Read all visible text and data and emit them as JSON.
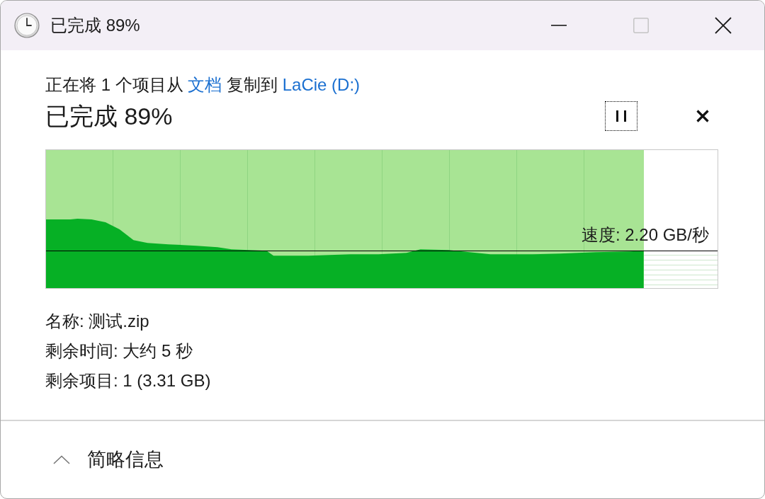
{
  "window": {
    "title": "已完成 89%",
    "maximize_disabled": true
  },
  "copy_summary": [
    {
      "kind": "text",
      "text": "正在将 1 个项目从"
    },
    {
      "kind": "link",
      "text": "文档"
    },
    {
      "kind": "text",
      "text": "复制到"
    },
    {
      "kind": "link",
      "text": "LaCie (D:)"
    }
  ],
  "status": {
    "text": "已完成 89%",
    "pause_focused": true
  },
  "progress": {
    "level": 0.89,
    "speed": "速度: 2.20 GB/秒"
  },
  "info": [
    "名称: 测试.zip",
    "剩余时间: 大约 5 秒",
    "剩余项目: 1 (3.31 GB)"
  ],
  "details": {
    "label": "简略信息",
    "expanded": true
  }
}
